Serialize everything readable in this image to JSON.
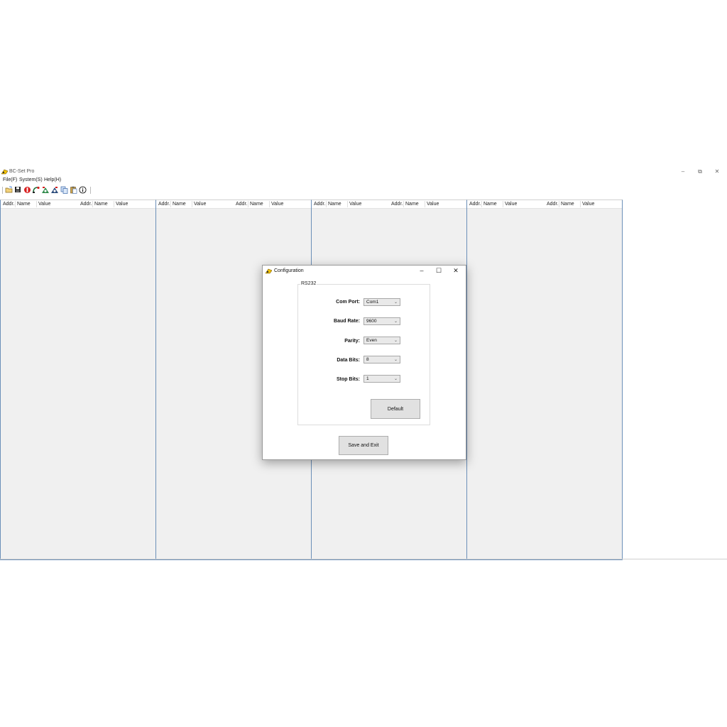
{
  "app": {
    "title": "BC-Set Pro",
    "window_controls": {
      "minimize": "–",
      "restore": "⧉",
      "close": "✕"
    }
  },
  "menu": [
    "File(F)",
    "System(S)",
    "Help(H)"
  ],
  "toolbar": [
    "open-icon",
    "save-icon",
    "stop-icon",
    "connect-icon",
    "read-icon",
    "write-icon",
    "copy-icon",
    "paste-icon",
    "info-icon"
  ],
  "panels": [
    {
      "columns": [
        "Addr.",
        "Name",
        "Value"
      ]
    },
    {
      "columns": [
        "Addr.",
        "Name",
        "Value"
      ]
    },
    {
      "columns": [
        "Addr.",
        "Name",
        "Value"
      ]
    },
    {
      "columns": [
        "Addr.",
        "Name",
        "Value"
      ]
    },
    {
      "columns": [
        "Addr.",
        "Name",
        "Value"
      ]
    },
    {
      "columns": [
        "Addr.",
        "Name",
        "Value"
      ]
    },
    {
      "columns": [
        "Addr.",
        "Name",
        "Value"
      ]
    },
    {
      "columns": [
        "Addr.",
        "Name",
        "Value"
      ]
    }
  ],
  "dialog": {
    "title": "Configuration",
    "controls": {
      "minimize": "–",
      "maximize": "☐",
      "close": "✕"
    },
    "group_label": "RS232",
    "fields": [
      {
        "label": "Com Port:",
        "value": "Com1"
      },
      {
        "label": "Baud Rate:",
        "value": "9600"
      },
      {
        "label": "Parity:",
        "value": "Even"
      },
      {
        "label": "Data Bits:",
        "value": "8"
      },
      {
        "label": "Stop Bits:",
        "value": "1"
      }
    ],
    "default_button": "Default",
    "save_button": "Save and Exit"
  }
}
